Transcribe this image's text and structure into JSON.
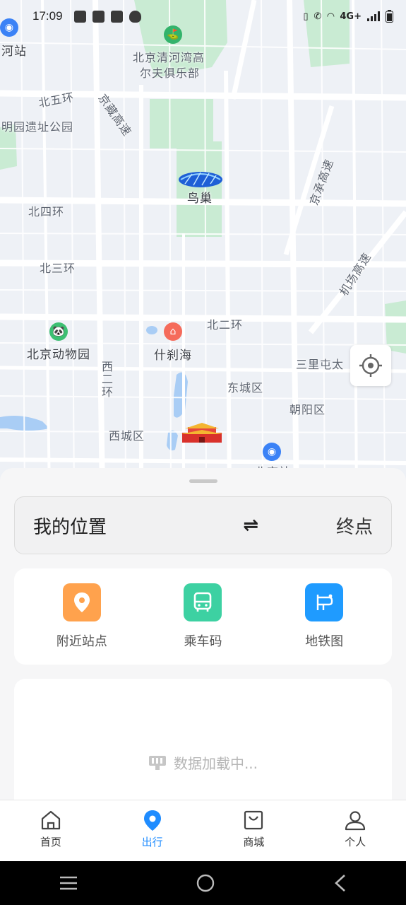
{
  "status_bar": {
    "time": "17:09",
    "network": "4G+",
    "icons": [
      "mail-notification-icon",
      "mail-notification-icon",
      "mail-notification-icon",
      "shield-notification-icon",
      "vibrate-icon",
      "call-icon",
      "wifi-icon",
      "signal-icon",
      "battery-icon"
    ]
  },
  "map": {
    "labels": {
      "hehe_station": "河站",
      "golf_club_line1": "北京清河湾高",
      "golf_club_line2": "尔夫俱乐部",
      "north_5th_ring": "北五环",
      "jingzang_highway": "京藏高速",
      "yuanmingyuan": "明园遗址公园",
      "jingcheng_highway": "京承高速",
      "birds_nest": "鸟巢",
      "north_4th_ring": "北四环",
      "north_3rd_ring": "北三环",
      "airport_highway": "机场高速",
      "north_2nd_ring": "北二环",
      "beijing_zoo": "北京动物园",
      "shichahai": "什刹海",
      "sanlitun": "三里屯太",
      "west_2nd_ring": "西二环",
      "dongcheng": "东城区",
      "chaoyang": "朝阳区",
      "xicheng": "西城区",
      "beijing_station_partial": "北京站"
    }
  },
  "route": {
    "start": "我的位置",
    "swap_symbol": "⇌",
    "end": "终点"
  },
  "quick_actions": [
    {
      "label": "附近站点",
      "color": "#ffa24d"
    },
    {
      "label": "乘车码",
      "color": "#3dd1a2"
    },
    {
      "label": "地铁图",
      "color": "#1f9bff"
    }
  ],
  "loading_text": "数据加载中...",
  "tabs": [
    {
      "label": "首页",
      "active": false
    },
    {
      "label": "出行",
      "active": true
    },
    {
      "label": "商城",
      "active": false
    },
    {
      "label": "个人",
      "active": false
    }
  ],
  "colors": {
    "accent": "#1f8cff",
    "map_green": "#c9ebd3",
    "map_water": "#a9cdf5"
  }
}
